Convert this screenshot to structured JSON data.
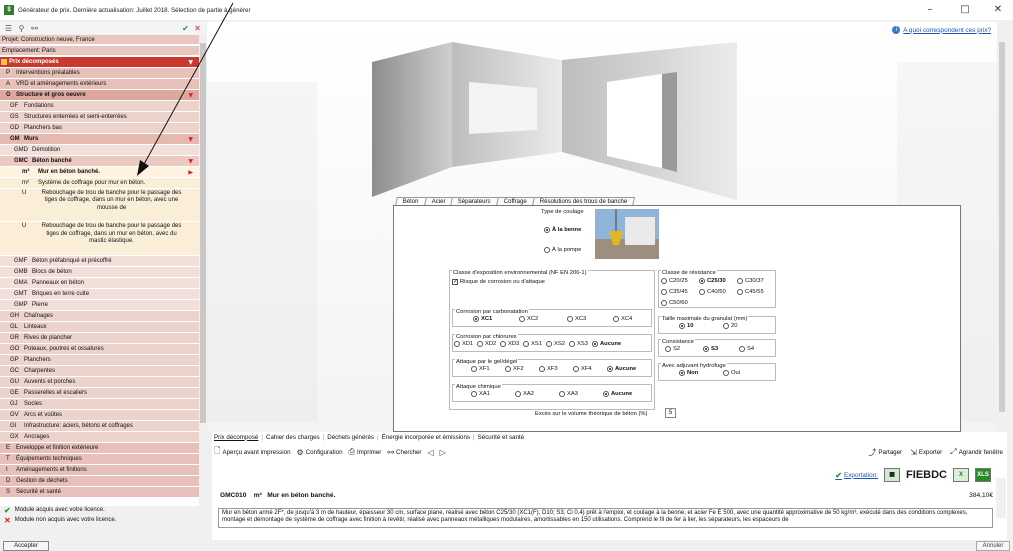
{
  "titlebar": {
    "title": "Générateur de prix. Dernière actualisation: Juillet 2018. Sélection de partie à générer",
    "minimize": "–",
    "maximize": "□",
    "close": "✕"
  },
  "tree": [
    {
      "id": "projet",
      "text": "Projet: Construction neuve, France",
      "level": 0,
      "bg": "#e9c7c0",
      "bold": false,
      "arrow": ""
    },
    {
      "id": "emplacement",
      "text": "Emplacement: Paris",
      "level": 0,
      "bg": "#e9c7c0",
      "bold": false,
      "arrow": ""
    },
    {
      "id": "prix",
      "text": "Prix décomposés",
      "level": 0,
      "bg": "#c9392d",
      "bold": true,
      "color": "#fff",
      "arrow": "▼"
    },
    {
      "id": "p",
      "code": "P",
      "text": "Interventions préalables",
      "level": 1,
      "bg": "#e7c1b9",
      "arrow": ""
    },
    {
      "id": "a",
      "code": "A",
      "text": "VRD et aménagements extérieurs",
      "level": 1,
      "bg": "#e7c1b9",
      "arrow": ""
    },
    {
      "id": "g",
      "code": "G",
      "text": "Structure et gros oeuvre",
      "level": 1,
      "bg": "#dea79d",
      "bold": true,
      "arrow": "▼"
    },
    {
      "id": "gf",
      "code": "GF",
      "text": "Fondations",
      "level": 2,
      "bg": "#ecd4cd",
      "arrow": ""
    },
    {
      "id": "gs",
      "code": "GS",
      "text": "Structures enterrées et semi-enterrées",
      "level": 2,
      "bg": "#ecd4cd",
      "arrow": ""
    },
    {
      "id": "gd",
      "code": "GD",
      "text": "Planchers bas",
      "level": 2,
      "bg": "#ecd4cd",
      "arrow": ""
    },
    {
      "id": "gm",
      "code": "GM",
      "text": "Murs",
      "level": 2,
      "bg": "#e5b9af",
      "bold": true,
      "arrow": "▼"
    },
    {
      "id": "gmd",
      "code": "GMD",
      "text": "Démolition",
      "level": 3,
      "bg": "#f3dfd9",
      "arrow": ""
    },
    {
      "id": "gmc",
      "code": "GMC",
      "text": "Béton banché",
      "level": 3,
      "bg": "#ecc9c1",
      "bold": true,
      "arrow": "▼"
    },
    {
      "id": "mur",
      "code": "m²",
      "text": "Mur en béton banché.",
      "level": 4,
      "bg": "#fff2de",
      "bold": true,
      "arrow": "▶"
    },
    {
      "id": "sys",
      "code": "m²",
      "text": "Système de coffrage pour mur en béton.",
      "level": 4,
      "bg": "#fbeed9",
      "arrow": ""
    },
    {
      "id": "reb1",
      "code": "U",
      "text": "Rebouchage de trou de banche pour le passage des tiges de coffrage, dans un mur en béton, avec une mousse de",
      "level": 4,
      "bg": "#fbeed9",
      "multiline": 4,
      "arrow": ""
    },
    {
      "id": "reb2",
      "code": "U",
      "text": "Rebouchage de trou de banche pour le passage des tiges de coffrage, dans un mur en béton, avec du mastic élastique.",
      "level": 4,
      "bg": "#fbeed9",
      "multiline": 4,
      "arrow": ""
    },
    {
      "id": "gmf",
      "code": "GMF",
      "text": "Béton préfabriqué et précoffré",
      "level": 3,
      "bg": "#f3dfd9",
      "arrow": ""
    },
    {
      "id": "gmb",
      "code": "GMB",
      "text": "Blocs de béton",
      "level": 3,
      "bg": "#f3dfd9",
      "arrow": ""
    },
    {
      "id": "gma",
      "code": "GMA",
      "text": "Panneaux en béton",
      "level": 3,
      "bg": "#f3dfd9",
      "arrow": ""
    },
    {
      "id": "gmt",
      "code": "GMT",
      "text": "Briques en terre cuite",
      "level": 3,
      "bg": "#f3dfd9",
      "arrow": ""
    },
    {
      "id": "gmp",
      "code": "GMP",
      "text": "Pierre",
      "level": 3,
      "bg": "#f3dfd9",
      "arrow": ""
    },
    {
      "id": "gh",
      "code": "GH",
      "text": "Chaînages",
      "level": 2,
      "bg": "#ecd4cd",
      "arrow": ""
    },
    {
      "id": "gl",
      "code": "GL",
      "text": "Linteaux",
      "level": 2,
      "bg": "#ecd4cd",
      "arrow": ""
    },
    {
      "id": "gr",
      "code": "GR",
      "text": "Rives de plancher",
      "level": 2,
      "bg": "#ecd4cd",
      "arrow": ""
    },
    {
      "id": "go",
      "code": "GO",
      "text": "Poteaux, poutres et ossatures",
      "level": 2,
      "bg": "#ecd4cd",
      "arrow": ""
    },
    {
      "id": "gp",
      "code": "GP",
      "text": "Planchers",
      "level": 2,
      "bg": "#ecd4cd",
      "arrow": ""
    },
    {
      "id": "gc",
      "code": "GC",
      "text": "Charpentes",
      "level": 2,
      "bg": "#ecd4cd",
      "arrow": ""
    },
    {
      "id": "gu",
      "code": "GU",
      "text": "Auvents et porches",
      "level": 2,
      "bg": "#ecd4cd",
      "arrow": ""
    },
    {
      "id": "ge",
      "code": "GE",
      "text": "Passerelles et escaliers",
      "level": 2,
      "bg": "#ecd4cd",
      "arrow": ""
    },
    {
      "id": "gj",
      "code": "GJ",
      "text": "Socles",
      "level": 2,
      "bg": "#ecd4cd",
      "arrow": ""
    },
    {
      "id": "gv",
      "code": "GV",
      "text": "Arcs et voûtes",
      "level": 2,
      "bg": "#ecd4cd",
      "arrow": ""
    },
    {
      "id": "gi",
      "code": "GI",
      "text": "Infrastructure: aciers, bétons et coffrages",
      "level": 2,
      "bg": "#ecd4cd",
      "arrow": ""
    },
    {
      "id": "gx",
      "code": "GX",
      "text": "Ancrages",
      "level": 2,
      "bg": "#ecd4cd",
      "arrow": ""
    },
    {
      "id": "e",
      "code": "E",
      "text": "Enveloppe et finition extérieure",
      "level": 1,
      "bg": "#e7c1b9",
      "arrow": ""
    },
    {
      "id": "t",
      "code": "T",
      "text": "Équipements techniques",
      "level": 1,
      "bg": "#e7c1b9",
      "arrow": ""
    },
    {
      "id": "i",
      "code": "I",
      "text": "Aménagements et finitions",
      "level": 1,
      "bg": "#e7c1b9",
      "arrow": ""
    },
    {
      "id": "d",
      "code": "D",
      "text": "Gestion de déchets",
      "level": 1,
      "bg": "#e7c1b9",
      "arrow": ""
    },
    {
      "id": "s",
      "code": "S",
      "text": "Sécurité et santé",
      "level": 1,
      "bg": "#e7c1b9",
      "arrow": ""
    }
  ],
  "status": {
    "acquired": "Module acquis avec votre licence.",
    "not_acquired": "Module non acquis avec votre licence."
  },
  "buttons": {
    "accept": "Accepter",
    "cancel": "Annuler"
  },
  "viewer": {
    "help_link": "A quoi correspondent ces prix?",
    "help_icon": "i"
  },
  "form": {
    "tabs": [
      "Béton",
      "Acier",
      "Séparateurs",
      "Coffrage",
      "Résolutions des trous de banche"
    ],
    "pouring_label": "Type de coulage",
    "pouring_options": [
      "À la benne",
      "À la pompe"
    ],
    "pouring_selected": 0,
    "exposure_label": "Classe d'exposition environnemental (NF EN 206-1)",
    "exposure_checkbox": "Risque de corrosion ou d'attaque",
    "carbonation_label": "Corrosion par carbonatation",
    "carbonation_options": [
      "XC1",
      "XC2",
      "XC3",
      "XC4"
    ],
    "carbonation_selected": 0,
    "chloride_label": "Corrosion par chlorures",
    "chloride_options": [
      "XD1",
      "XD2",
      "XD3",
      "XS1",
      "XS2",
      "XS3",
      "Aucune"
    ],
    "chloride_selected": 6,
    "frost_label": "Attaque par le gel/dégel",
    "frost_options": [
      "XF1",
      "XF2",
      "XF3",
      "XF4",
      "Aucune"
    ],
    "frost_selected": 4,
    "chemical_label": "Attaque chimique",
    "chemical_options": [
      "XA1",
      "XA2",
      "XA3",
      "Aucune"
    ],
    "chemical_selected": 3,
    "resistance_label": "Classe de résistance",
    "resistance_options": [
      "C20/25",
      "C25/30",
      "C30/37",
      "C35/45",
      "C40/50",
      "C45/55",
      "C50/60"
    ],
    "resistance_selected": 1,
    "aggregate_label": "Taille maximale du granulat (mm)",
    "aggregate_options": [
      "10",
      "20"
    ],
    "aggregate_selected": 0,
    "consistency_label": "Consistance",
    "consistency_options": [
      "S2",
      "S3",
      "S4"
    ],
    "consistency_selected": 1,
    "admixture_label": "Avec adjuvant hydrofuge",
    "admixture_options": [
      "Non",
      "Oui"
    ],
    "admixture_selected": 0,
    "excess_label": "Excès sur le volume théorique de béton (%)",
    "excess_value": "5"
  },
  "bottom": {
    "tabs": [
      "Prix décomposé",
      "Cahier des charges",
      "Déchets générés",
      "Énergie incorporée et émissions",
      "Sécurité et santé"
    ],
    "toolbar": [
      "Aperçu avant impression",
      "Configuration",
      "Imprimer",
      "Chercher"
    ],
    "share": "Partager",
    "export": "Exporter",
    "enlarge": "Agrandir fenêtre",
    "export_label": "Exportation:",
    "export_formats": [
      "FIEBDC",
      "XLS"
    ],
    "code": "GMC010",
    "unit": "m²",
    "name": "Mur en béton banché.",
    "price": "384,10€",
    "description": "Mur en béton armé 2F*, de jusqu'à 3 m de hauteur, épaisseur 30 cm, surface plane, réalisé avec béton C25/30 (XC1(F); D10; S3; Cl 0,4) prêt à l'emploi, et coulage à la benne, et acier Fe E 500, avec une quantité approximative de 50 kg/m³, exécuté dans des conditions complexes, montage et démontage de système de coffrage avec finition à revêtir, réalisé avec panneaux métalliques modulaires, amortissables en 150 utilisations. Comprend le fil de fer à lier, les séparateurs, les espaceurs de"
  },
  "colors": {
    "accent_red": "#c9392d",
    "link_blue": "#1a55c0",
    "ok_green": "#2a9a2a"
  }
}
